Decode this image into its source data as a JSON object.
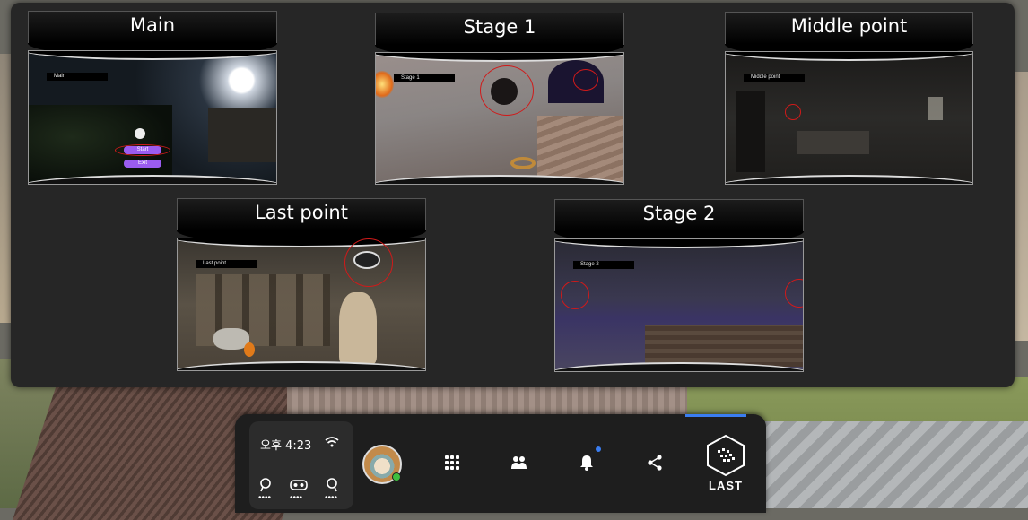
{
  "panel": {
    "cards": [
      {
        "title": "Main",
        "ingame_label": "Main",
        "buttons": [
          "Start",
          "Exit"
        ]
      },
      {
        "title": "Stage 1",
        "ingame_label": "Stage 1"
      },
      {
        "title": "Middle point",
        "ingame_label": "Middle point"
      },
      {
        "title": "Last point",
        "ingame_label": "Last point"
      },
      {
        "title": "Stage 2",
        "ingame_label": "Stage 2"
      }
    ]
  },
  "menubar": {
    "time": "오후 4:23",
    "device_dots": "••••",
    "icons": {
      "wifi": "wifi-icon",
      "apps": "apps-grid-icon",
      "people": "people-icon",
      "notifications": "bell-icon",
      "share": "share-icon",
      "app_logo": "last-logo-icon"
    },
    "app_label": "LAST"
  },
  "colors": {
    "panel_bg": "#262626",
    "accent_blue": "#3a7df0",
    "highlight_red": "#d01a1a",
    "menu_button_purple": "#9b5cf0"
  }
}
